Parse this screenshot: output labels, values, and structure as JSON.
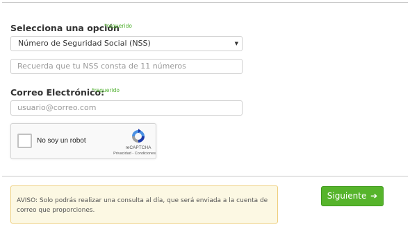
{
  "form": {
    "option": {
      "label": "Selecciona una opción",
      "required_tag": "*requerido",
      "selected": "Número de Seguridad Social (NSS)",
      "caret": "▼"
    },
    "nss_input": {
      "placeholder": "Recuerda que tu NSS consta de 11 números",
      "value": ""
    },
    "email": {
      "label": "Correo Electrónico:",
      "required_tag": "*requerido",
      "placeholder": "usuario@correo.com",
      "value": ""
    }
  },
  "captcha": {
    "label": "No soy un robot",
    "brand": "reCAPTCHA",
    "links": "Privacidad - Condiciones"
  },
  "notice": {
    "text": "AVISO: Solo podrás realizar una consulta al día, que será enviada a la cuenta de correo que proporciones."
  },
  "submit": {
    "label": "Siguiente",
    "icon": "arrow-right-icon"
  },
  "colors": {
    "accent_green": "#56b42b",
    "required_green": "#4caf2a",
    "notice_bg": "#fcf8e3",
    "notice_border": "#eecf7e"
  }
}
